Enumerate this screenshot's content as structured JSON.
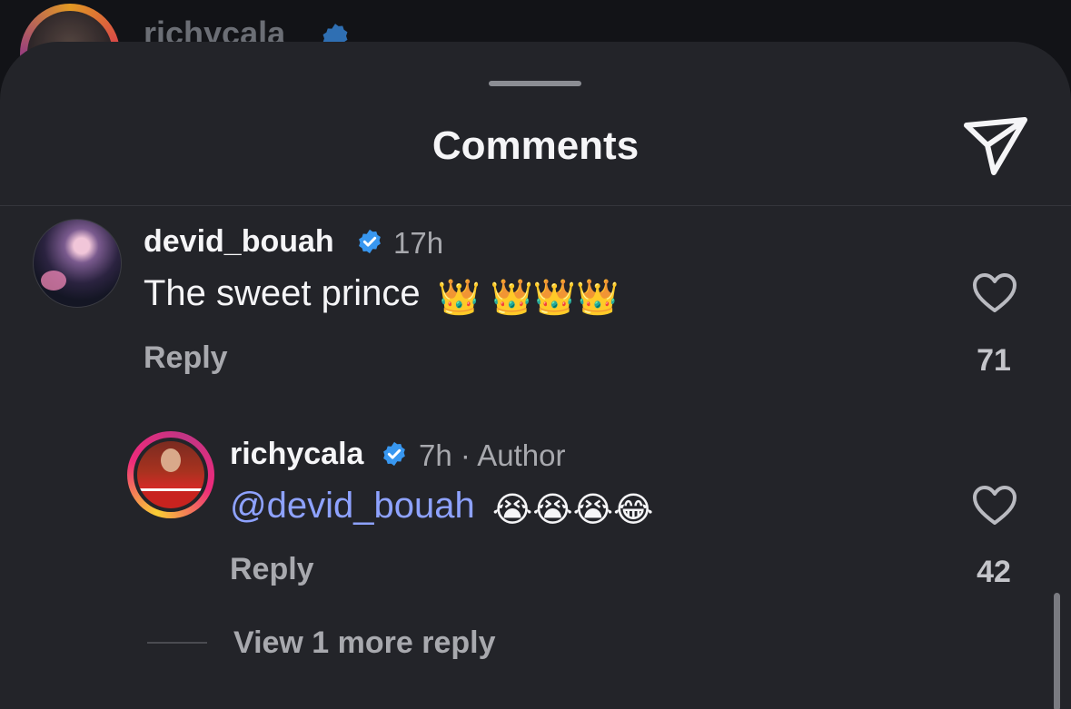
{
  "background_post": {
    "username": "richycala"
  },
  "sheet": {
    "title": "Comments",
    "share_icon": "send-icon"
  },
  "comments": [
    {
      "username": "devid_bouah",
      "verified": true,
      "time": "17h",
      "text": "The sweet prince",
      "emojis": "👑 👑👑👑",
      "reply_label": "Reply",
      "likes": "71"
    }
  ],
  "replies": [
    {
      "username": "richycala",
      "verified": true,
      "time": "7h",
      "meta_suffix": "· Author",
      "mention": "@devid_bouah",
      "emojis": "😭😭😭😂",
      "reply_label": "Reply",
      "likes": "42"
    }
  ],
  "more_replies_label": "View 1 more reply",
  "colors": {
    "sheet_bg": "#232429",
    "verified_blue": "#3897f0",
    "mention_blue": "#8ea2ff",
    "secondary_text": "#a8a9ae"
  }
}
